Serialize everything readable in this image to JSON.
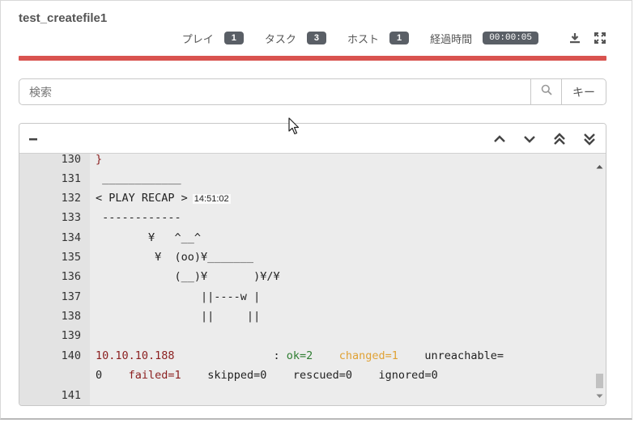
{
  "header": {
    "title": "test_createfile1",
    "stats": [
      {
        "label": "プレイ",
        "value": "1"
      },
      {
        "label": "タスク",
        "value": "3"
      },
      {
        "label": "ホスト",
        "value": "1"
      },
      {
        "label": "経過時間",
        "value": "00:00:05"
      }
    ],
    "icons": [
      "download-icon",
      "expand-icon"
    ]
  },
  "progress": {
    "fraction": 1.0,
    "color": "#d9534f"
  },
  "search": {
    "placeholder": "検索",
    "value": "",
    "key_button_label": "キー"
  },
  "log": {
    "collapse_label": "−",
    "nav_icons": [
      "chevron-up-icon",
      "chevron-down-icon",
      "double-chevron-up-icon",
      "double-chevron-down-icon"
    ],
    "lines": [
      {
        "num": "130",
        "text": "}",
        "class": "c-red"
      },
      {
        "num": "131",
        "text": " ____________"
      },
      {
        "num": "132",
        "text": "< PLAY RECAP >",
        "timestamp": "14:51:02"
      },
      {
        "num": "133",
        "text": " ------------"
      },
      {
        "num": "134",
        "text": "        ¥   ^__^"
      },
      {
        "num": "135",
        "text": "         ¥  (oo)¥_______"
      },
      {
        "num": "136",
        "text": "            (__)¥       )¥/¥"
      },
      {
        "num": "137",
        "text": "                ||----w |"
      },
      {
        "num": "138",
        "text": "                ||     ||"
      },
      {
        "num": "139",
        "text": ""
      },
      {
        "num": "140",
        "host": "10.10.10.188",
        "sep": "               : ",
        "ok": "ok=2",
        "changed": "changed=1",
        "unreachable": "unreachable="
      },
      {
        "num": "",
        "zero": "0",
        "failed": "failed=1",
        "skipped": "skipped=0",
        "rescued": "rescued=0",
        "ignored": "ignored=0"
      },
      {
        "num": "141",
        "text": ""
      }
    ]
  },
  "colors": {
    "ok": "#2f7d32",
    "changed": "#e0a235",
    "failed": "#8b1f1f",
    "badge": "#5a5f66"
  }
}
